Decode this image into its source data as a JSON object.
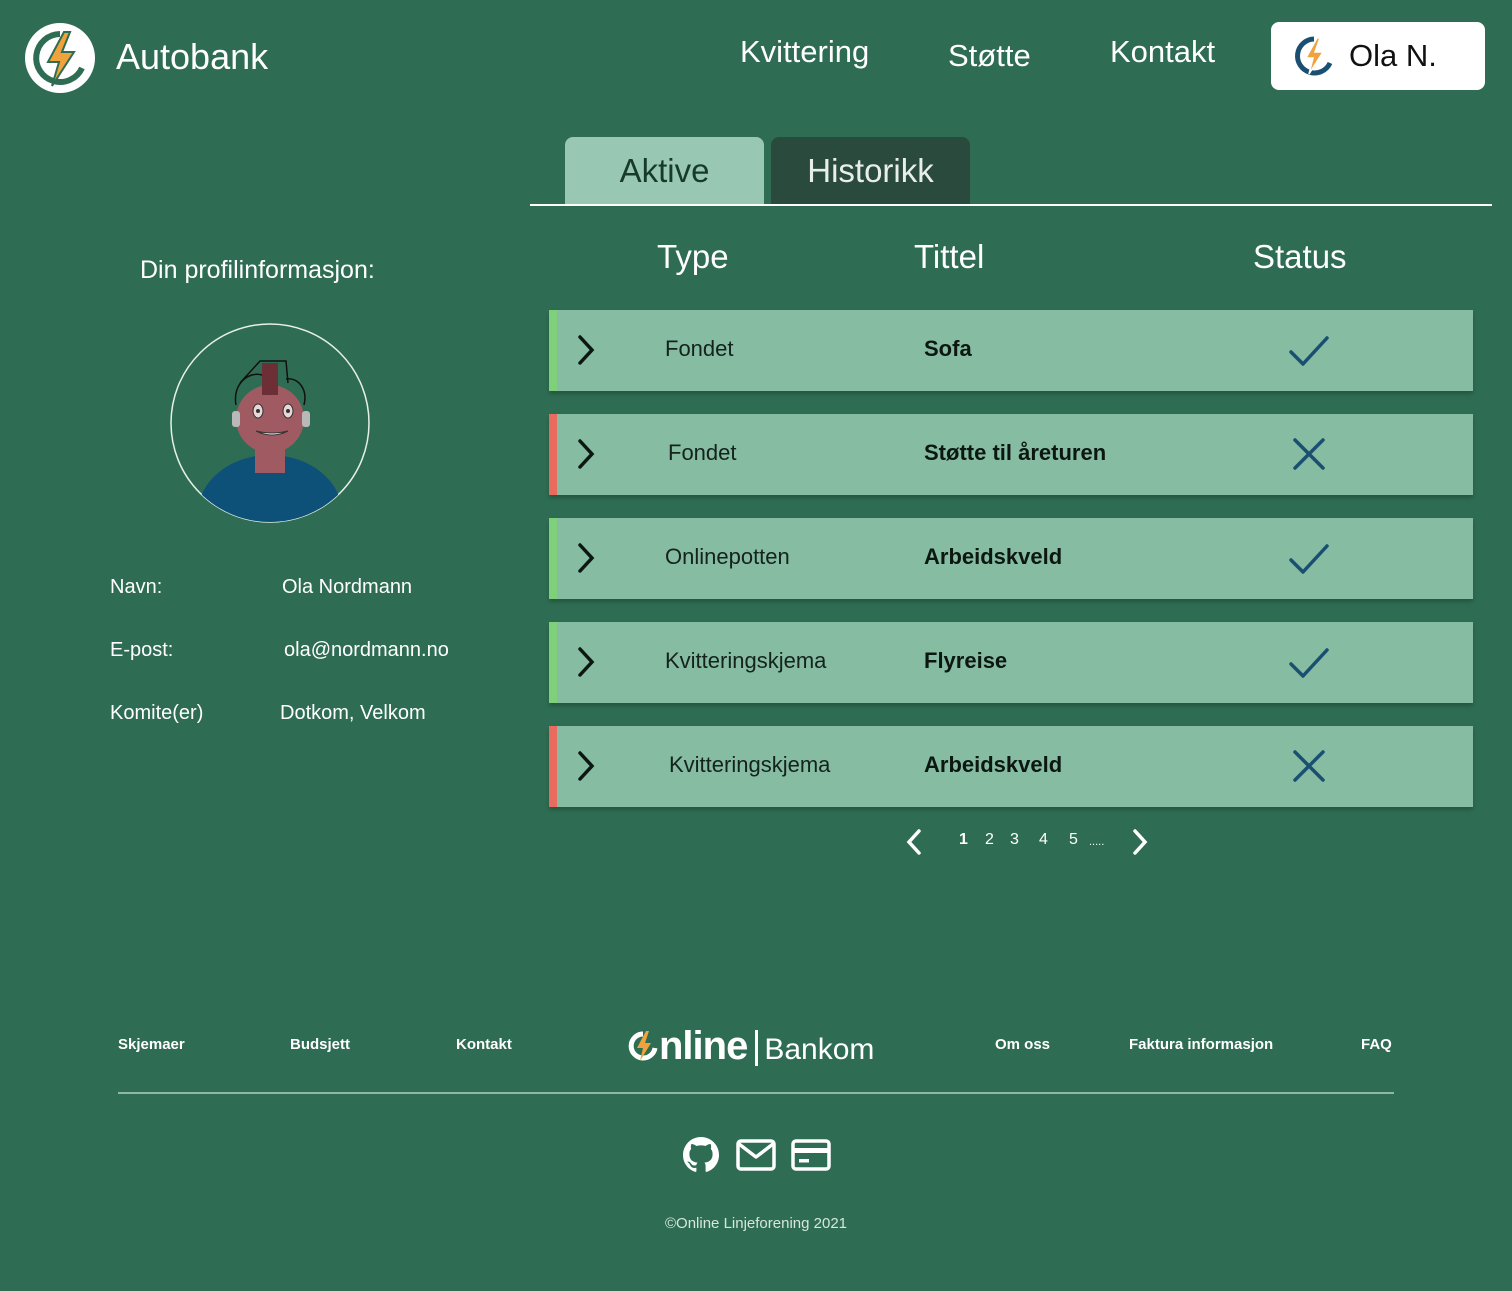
{
  "header": {
    "brand": "Autobank",
    "nav": [
      "Kvittering",
      "Støtte",
      "Kontakt"
    ],
    "user": "Ola N."
  },
  "tabs": [
    "Aktive",
    "Historikk"
  ],
  "profile": {
    "title": "Din profilinformasjon:",
    "fields": [
      {
        "label": "Navn:",
        "value": "Ola Nordmann"
      },
      {
        "label": "E-post:",
        "value": "ola@nordmann.no"
      },
      {
        "label": "Komite(er)",
        "value": "Dotkom, Velkom"
      }
    ]
  },
  "table": {
    "columns": [
      "Type",
      "Tittel",
      "Status"
    ],
    "rows": [
      {
        "type": "Fondet",
        "title": "Sofa",
        "status": "approved"
      },
      {
        "type": "Fondet",
        "title": "Støtte til åreturen",
        "status": "rejected"
      },
      {
        "type": "Onlinepotten",
        "title": "Arbeidskveld",
        "status": "approved"
      },
      {
        "type": "Kvitteringskjema",
        "title": "Flyreise",
        "status": "approved"
      },
      {
        "type": "Kvitteringskjema",
        "title": "Arbeidskveld",
        "status": "rejected"
      }
    ]
  },
  "pagination": {
    "pages": [
      "1",
      "2",
      "3",
      "4",
      "5",
      "....."
    ],
    "current": "1"
  },
  "footer": {
    "links_left": [
      "Skjemaer",
      "Budsjett",
      "Kontakt"
    ],
    "logo_online": "nline",
    "logo_bankom": "Bankom",
    "links_right": [
      "Om oss",
      "Faktura informasjon",
      "FAQ"
    ],
    "icons": [
      "github-icon",
      "mail-icon",
      "credit-card-icon"
    ],
    "copyright": "©Online Linjeforening 2021"
  },
  "colors": {
    "background": "#2e6d53",
    "row": "#85bca2",
    "approved_accent": "#7ed07a",
    "rejected_accent": "#e96a5e",
    "status_icon": "#1b4f72",
    "bolt": "#f0a23c"
  }
}
